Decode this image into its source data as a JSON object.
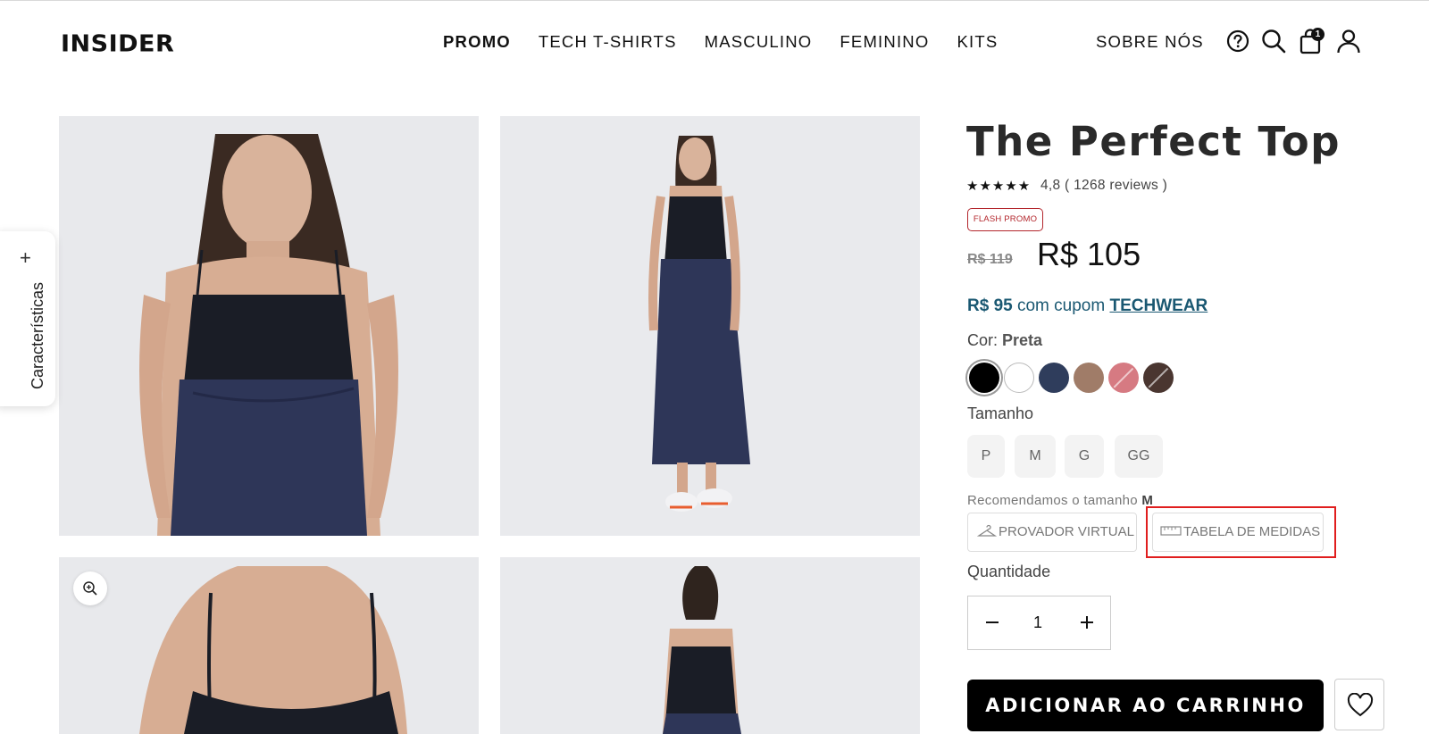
{
  "header": {
    "logo": "INSIDER",
    "nav": [
      "PROMO",
      "TECH T-SHIRTS",
      "MASCULINO",
      "FEMININO",
      "KITS"
    ],
    "sobre": "SOBRE NÓS",
    "cart_count": "1",
    "icons": [
      "help-icon",
      "search-icon",
      "cart-icon",
      "user-icon"
    ]
  },
  "side_tab": {
    "plus": "+",
    "label": "Características"
  },
  "product": {
    "title": "The Perfect Top",
    "stars": "★★★★★",
    "rating": "4,8 ( 1268 reviews )",
    "badge": "FLASH PROMO",
    "old_price": "R$ 119",
    "price": "R$ 105",
    "coupon_value": "R$ 95",
    "coupon_text": " com cupom ",
    "coupon_code": "TECHWEAR",
    "color_label": "Cor: ",
    "color_value": "Preta",
    "colors": [
      "#000000",
      "#ffffff",
      "#2f3d5c",
      "#a07c68",
      "#d67a82",
      "#4a3630"
    ],
    "size_label": "Tamanho",
    "sizes": [
      "P",
      "M",
      "G",
      "GG"
    ],
    "recommend_text": "Recomendamos o tamanho ",
    "recommend_size": "M",
    "virtual_fitting": "PROVADOR VIRTUAL",
    "size_chart": "TABELA DE MEDIDAS",
    "qty_label": "Quantidade",
    "qty_value": "1",
    "add_to_cart": "ADICIONAR AO CARRINHO"
  }
}
